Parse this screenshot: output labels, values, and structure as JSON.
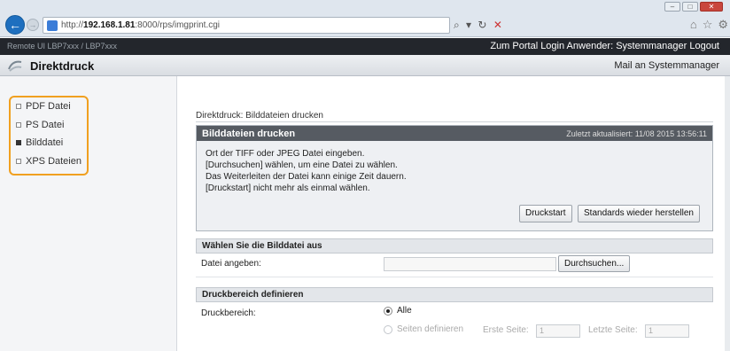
{
  "browser": {
    "url_prefix": "http://",
    "url_host": "192.168.1.81",
    "url_rest": ":8000/rps/imgprint.cgi",
    "window_buttons": [
      "–",
      "□",
      "✕"
    ],
    "search_controls": "⌕ ▾ ↻",
    "search_close": "✕"
  },
  "device_bar": {
    "device_name": "Remote UI    LBP7xxx / LBP7xxx",
    "links": "Zum Portal  Login Anwender: Systemmanager Logout"
  },
  "header": {
    "title": "Direktdruck",
    "mail_link": "Mail an Systemmanager"
  },
  "sidebar": {
    "items": [
      {
        "label": "PDF Datei",
        "active": false
      },
      {
        "label": "PS Datei",
        "active": false
      },
      {
        "label": "Bilddatei",
        "active": true
      },
      {
        "label": "XPS Dateien",
        "active": false
      }
    ]
  },
  "main": {
    "breadcrumb": "Direktdruck: Bilddateien drucken",
    "panel": {
      "title": "Bilddateien drucken",
      "timestamp": "Zuletzt aktualisiert: 11/08 2015 13:56:11",
      "lines": [
        "Ort der TIFF oder JPEG Datei eingeben.",
        "[Durchsuchen] wählen, um eine Datei zu wählen.",
        "Das Weiterleiten der Datei kann einige Zeit dauern.",
        "[Druckstart] nicht mehr als einmal wählen."
      ],
      "start_button": "Druckstart",
      "reset_button": "Standards wieder herstellen"
    },
    "select_section": {
      "title": "Wählen Sie die Bilddatei aus",
      "file_label": "Datei angeben:",
      "browse_button": "Durchsuchen..."
    },
    "range_section": {
      "title": "Druckbereich definieren",
      "range_label": "Druckbereich:",
      "option_all": "Alle",
      "option_define": "Seiten definieren",
      "first_page_label": "Erste Seite:",
      "first_page_value": "1",
      "last_page_label": "Letzte Seite:",
      "last_page_value": "1"
    }
  },
  "colors": {
    "highlight": "#f0a020",
    "panel_header": "#565b62",
    "device_bar": "#23262c"
  }
}
